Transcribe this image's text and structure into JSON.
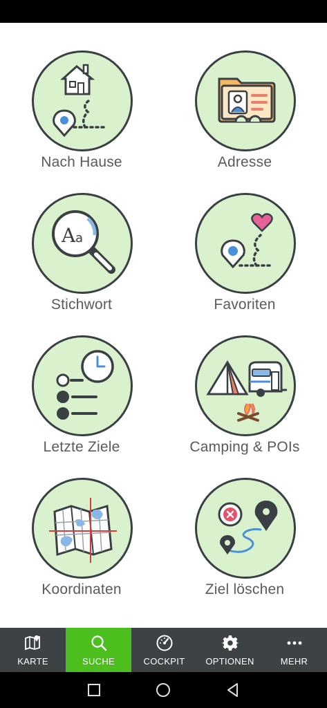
{
  "tiles": [
    {
      "label": "Nach Hause",
      "icon": "home-route-icon"
    },
    {
      "label": "Adresse",
      "icon": "address-card-icon"
    },
    {
      "label": "Stichwort",
      "icon": "keyword-search-icon"
    },
    {
      "label": "Favoriten",
      "icon": "favorite-route-icon"
    },
    {
      "label": "Letzte Ziele",
      "icon": "recent-destinations-icon"
    },
    {
      "label": "Camping & POIs",
      "icon": "camping-icon"
    },
    {
      "label": "Koordinaten",
      "icon": "coordinates-map-icon"
    },
    {
      "label": "Ziel löschen",
      "icon": "clear-destination-icon"
    }
  ],
  "bottom_nav": [
    {
      "label": "KARTE",
      "icon": "map-icon",
      "active": false
    },
    {
      "label": "SUCHE",
      "icon": "search-icon",
      "active": true
    },
    {
      "label": "COCKPIT",
      "icon": "speedometer-icon",
      "active": false
    },
    {
      "label": "OPTIONEN",
      "icon": "gear-icon",
      "active": false
    },
    {
      "label": "MEHR",
      "icon": "more-dots-icon",
      "active": false
    }
  ],
  "colors": {
    "tile_fill": "#d9f2cd",
    "tile_border": "#3a3f44",
    "nav_background": "#3d4245",
    "nav_active": "#4cbe1d",
    "label_text": "#5a5a5a"
  }
}
